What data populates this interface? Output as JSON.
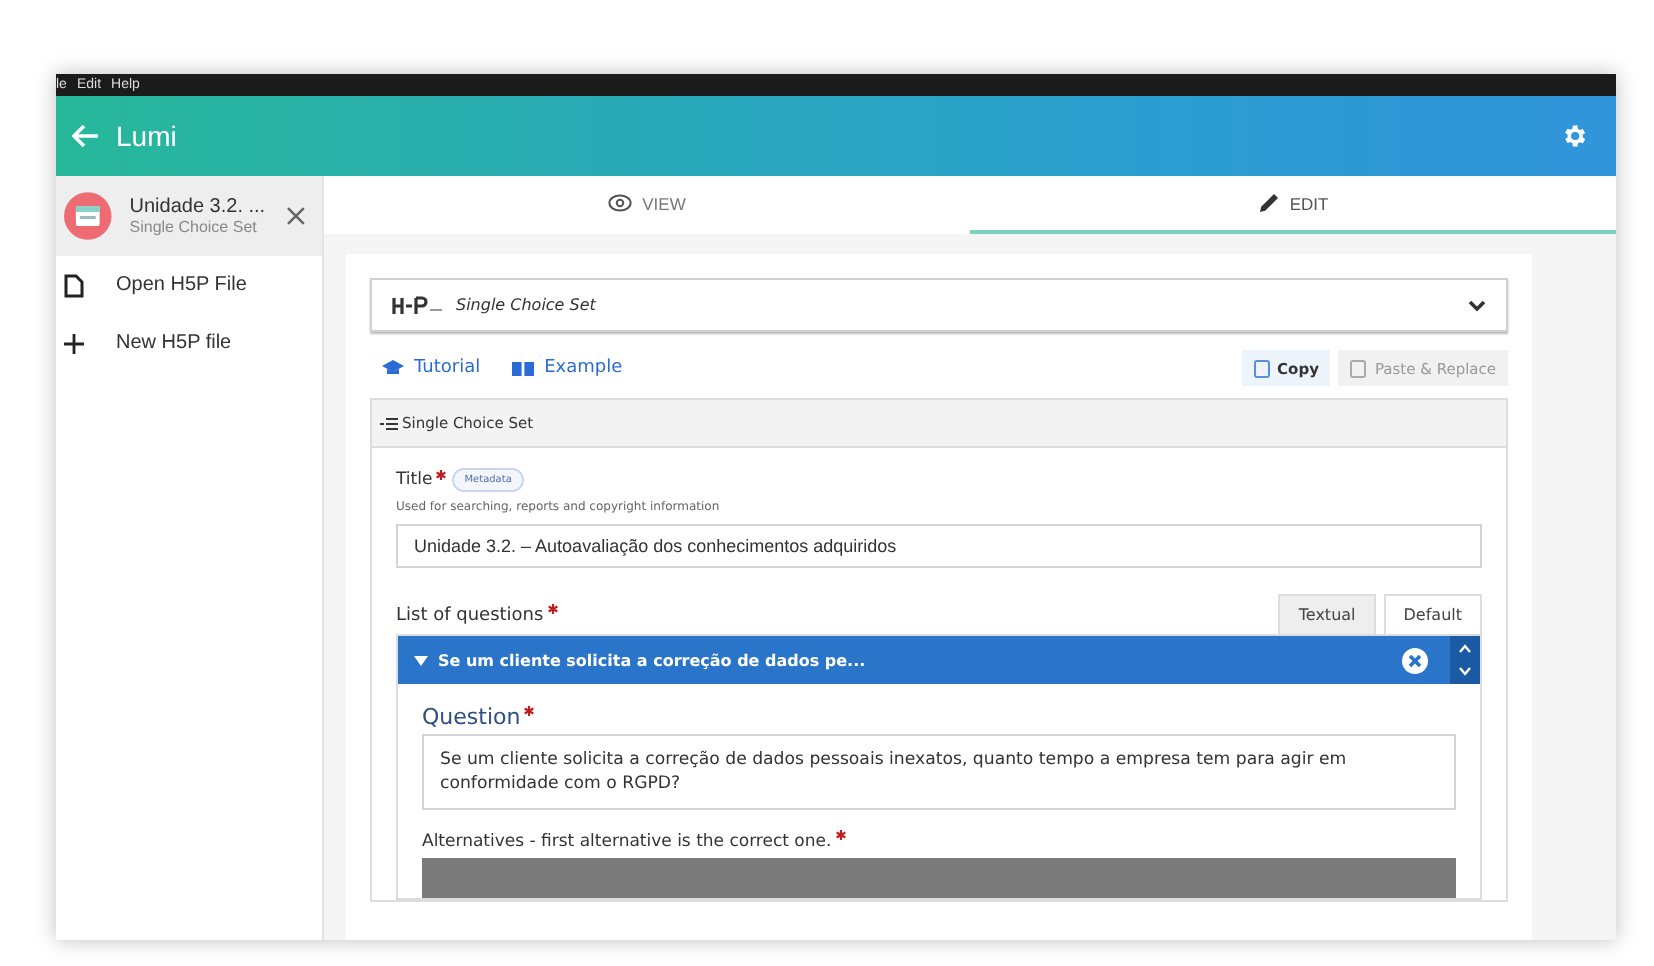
{
  "menu": [
    "le",
    "Edit",
    "Help"
  ],
  "app_bar": {
    "title": "Lumi"
  },
  "sidebar": {
    "file": {
      "title": "Unidade 3.2. ...",
      "subtitle": "Single Choice Set",
      "selected": true
    },
    "actions": [
      {
        "label": "Open H5P File",
        "kind": "file"
      },
      {
        "label": "New H5P file",
        "kind": "add"
      }
    ]
  },
  "tabs": [
    {
      "label": "VIEW",
      "kind": "view",
      "selected": false
    },
    {
      "label": "EDIT",
      "kind": "edit",
      "selected": true
    }
  ],
  "editor": {
    "content_type": "Single Choice Set",
    "links": [
      {
        "label": "Tutorial",
        "kind": "tutorial"
      },
      {
        "label": "Example",
        "kind": "example"
      }
    ],
    "buttons": [
      {
        "label": "Copy",
        "disabled": false
      },
      {
        "label": "Paste & Replace",
        "disabled": true
      }
    ],
    "section": "Single Choice Set",
    "title_field": {
      "label": "Title",
      "required": true,
      "badge": "Metadata",
      "description": "Used for searching, reports and copyright information",
      "value": "Unidade 3.2. – Autoavaliação dos conhecimentos adquiridos"
    },
    "questions": {
      "label": "List of questions",
      "required": true,
      "view_tabs": [
        {
          "label": "Textual",
          "selected": false
        },
        {
          "label": "Default",
          "selected": true
        }
      ],
      "item": {
        "title": "Se um cliente solicita a correção de dados pe...",
        "expanded": true,
        "question_label": "Question",
        "question_required": true,
        "question_value": "Se um cliente solicita a correção de dados pessoais inexatos, quanto tempo a empresa tem para agir em conformidade com o RGPD?",
        "alternatives_label": "Alternatives - first alternative is the correct one.",
        "alternatives_required": true
      }
    }
  }
}
